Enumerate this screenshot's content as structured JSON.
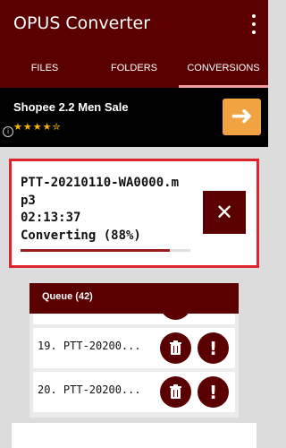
{
  "app": {
    "title": "OPUS Converter"
  },
  "tabs": [
    {
      "label": "FILES",
      "active": false
    },
    {
      "label": "FOLDERS",
      "active": false
    },
    {
      "label": "CONVERSIONS",
      "active": true
    }
  ],
  "ad": {
    "title": "Shopee 2.2 Men Sale",
    "rating_stars": 4.5
  },
  "current": {
    "file_name": "PTT-20210110-WA0000.mp3",
    "elapsed": "02:13:37",
    "status": "Converting (88%)",
    "progress": 0.88
  },
  "queue": {
    "title": "Queue (42)",
    "items": [
      {
        "label": "19. PTT-20200..."
      },
      {
        "label": "20. PTT-20200..."
      }
    ]
  },
  "colors": {
    "primary": "#5a0000",
    "accent": "#e0242d",
    "ad_arrow": "#f1a341",
    "star": "#f6b400"
  },
  "icons": {
    "menu": "overflow-menu-icon",
    "close": "close-icon",
    "trash": "trash-icon",
    "alert": "alert-icon",
    "arrow": "arrow-right-icon",
    "info": "info-icon"
  }
}
